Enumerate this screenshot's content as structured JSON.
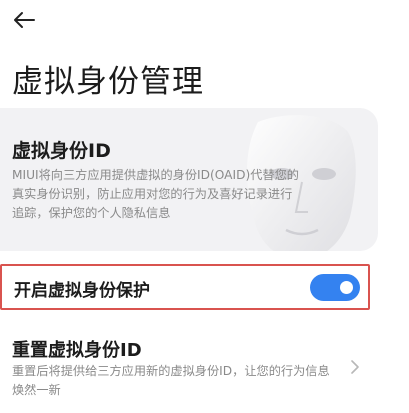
{
  "header": {
    "back_icon": "arrow-left-icon",
    "title": "虚拟身份管理"
  },
  "info_card": {
    "title": "虚拟身份ID",
    "description": "MIUI将向三方应用提供虚拟的身份ID(OAID)代替您的真实身份识别，防止应用对您的行为及喜好记录进行追踪，保护您的个人隐私信息",
    "decor_icon": "face-mask-icon"
  },
  "toggle_row": {
    "label": "开启虚拟身份保护",
    "enabled": true,
    "accent_color": "#3482f0",
    "highlight_color": "#d9534f"
  },
  "reset_row": {
    "title": "重置虚拟身份ID",
    "description": "重置后将提供给三方应用新的虚拟身份ID，让您的行为信息焕然一新",
    "chevron_icon": "chevron-right-icon"
  }
}
